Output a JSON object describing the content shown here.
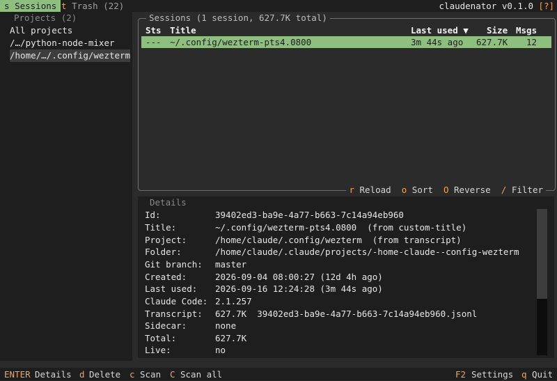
{
  "topbar": {
    "sessions_key": "s",
    "sessions_label": "Sessions",
    "trash_key": "t",
    "trash_label": "Trash (22)",
    "app_version": "claudenator v0.1.0",
    "help": "[?]"
  },
  "projects": {
    "title": "Projects (2)",
    "items": [
      {
        "label": "All projects",
        "selected": false
      },
      {
        "label": "/…/python-node-mixer",
        "selected": false
      },
      {
        "label": "/home/…/.config/wezterm",
        "selected": true
      }
    ]
  },
  "sessions": {
    "title": "Sessions (1 session, 627.7K total)",
    "columns": {
      "sts": "Sts",
      "title": "Title",
      "last_used": "Last used ▼",
      "size": "Size",
      "msgs": "Msgs"
    },
    "rows": [
      {
        "sts": "---",
        "title": "~/.config/wezterm-pts4.0800",
        "last_used": "3m 44s ago",
        "size": "627.7K",
        "msgs": "12"
      }
    ],
    "footer": [
      {
        "key": "r",
        "label": "Reload"
      },
      {
        "key": "o",
        "label": "Sort"
      },
      {
        "key": "O",
        "label": "Reverse"
      },
      {
        "key": "/",
        "label": "Filter"
      }
    ]
  },
  "details": {
    "title": "Details",
    "fields": [
      {
        "label": "Id:",
        "value": "39402ed3-ba9e-4a77-b663-7c14a94eb960"
      },
      {
        "label": "Title:",
        "value": "~/.config/wezterm-pts4.0800  (from custom-title)"
      },
      {
        "label": "Project:",
        "value": "/home/claude/.config/wezterm  (from transcript)"
      },
      {
        "label": "Folder:",
        "value": "/home/claude/.claude/projects/-home-claude--config-wezterm"
      },
      {
        "label": "Git branch:",
        "value": "master"
      },
      {
        "label": "Created:",
        "value": "2026-09-04 08:00:27 (12d 4h ago)"
      },
      {
        "label": "Last used:",
        "value": "2026-09-16 12:24:28 (3m 44s ago)"
      },
      {
        "label": "Claude Code:",
        "value": "2.1.257"
      },
      {
        "label": "Transcript:",
        "value": "627.7K  39402ed3-ba9e-4a77-b663-7c14a94eb960.jsonl"
      },
      {
        "label": "Sidecar:",
        "value": "none"
      },
      {
        "label": "Total:",
        "value": "627.7K"
      },
      {
        "label": "Live:",
        "value": "no"
      }
    ]
  },
  "bottombar": {
    "left": [
      {
        "key": "ENTER",
        "label": "Details"
      },
      {
        "key": "d",
        "label": "Delete"
      },
      {
        "key": "c",
        "label": "Scan"
      },
      {
        "key": "C",
        "label": "Scan all"
      }
    ],
    "right": [
      {
        "key": "F2",
        "label": "Settings"
      },
      {
        "key": "q",
        "label": "Quit"
      }
    ]
  }
}
